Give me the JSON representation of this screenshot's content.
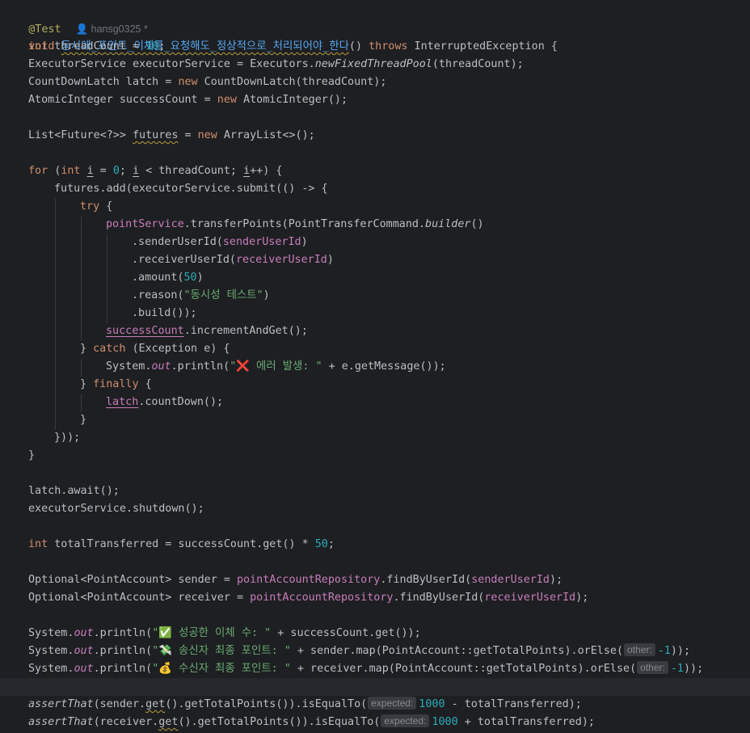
{
  "header": {
    "annotation": "@Test",
    "author": "hansg0325 *",
    "void_kw": "void",
    "method_name": "동시에_포인트_이체를_요청해도_정상적으로_처리되어야_한다",
    "method_params": "() ",
    "throws_kw": "throws",
    "method_tail": " InterruptedException {"
  },
  "icons": {
    "author": "person-icon",
    "error": "cross-mark-icon",
    "success": "check-mark-icon",
    "sender": "money-wings-icon",
    "receiver": "money-bag-icon"
  },
  "colors": {
    "background": "#1e1f22",
    "keyword": "#cf8e6d",
    "string": "#6aab73",
    "number": "#2aacb8",
    "field": "#c77dbb"
  },
  "code": {
    "l1_kw": "int",
    "l1_a": " threadCount = ",
    "l1_num": "10",
    "l1_b": ";",
    "l2_a": "ExecutorService executorService = Executors.",
    "l2_m": "newFixedThreadPool",
    "l2_b": "(threadCount);",
    "l3_a": "CountDownLatch latch = ",
    "l3_kw": "new",
    "l3_b": " CountDownLatch(threadCount);",
    "l4_a": "AtomicInteger successCount = ",
    "l4_kw": "new",
    "l4_b": " AtomicInteger();",
    "l5_a": "List<Future<?>> ",
    "l5_v": "futures",
    "l5_b": " = ",
    "l5_kw": "new",
    "l5_c": " ArrayList<>();",
    "l6_kw1": "for",
    "l6_a": " (",
    "l6_kw2": "int",
    "l6_b": " ",
    "l6_i1": "i",
    "l6_c": " = ",
    "l6_num": "0",
    "l6_d": "; ",
    "l6_i2": "i",
    "l6_e": " < threadCount; ",
    "l6_i3": "i",
    "l6_f": "++) {",
    "l7": "futures.add(executorService.submit(() -> {",
    "l8_kw": "try",
    "l8_b": " {",
    "l9_f": "pointService",
    "l9_a": ".transferPoints(PointTransferCommand.",
    "l9_m": "builder",
    "l9_b": "()",
    "l10_a": ".senderUserId(",
    "l10_f": "senderUserId",
    "l10_b": ")",
    "l11_a": ".receiverUserId(",
    "l11_f": "receiverUserId",
    "l11_b": ")",
    "l12_a": ".amount(",
    "l12_num": "50",
    "l12_b": ")",
    "l13_a": ".reason(",
    "l13_str": "\"동시성 테스트\"",
    "l13_b": ")",
    "l14": ".build());",
    "l15_f": "successCount",
    "l15_a": ".incrementAndGet();",
    "l16_a": "} ",
    "l16_kw": "catch",
    "l16_b": " (Exception e) {",
    "l17_a": "System.",
    "l17_out": "out",
    "l17_b": ".println(",
    "l17_q": "\"",
    "l17_icon": "❌",
    "l17_str": " 에러 발생: \"",
    "l17_c": " + e.getMessage());",
    "l18_a": "} ",
    "l18_kw": "finally",
    "l18_b": " {",
    "l19_f": "latch",
    "l19_a": ".countDown();",
    "l20": "}",
    "l21": "}));",
    "l22": "}",
    "l23": "latch.await();",
    "l24": "executorService.shutdown();",
    "l25_kw": "int",
    "l25_a": " totalTransferred = successCount.get() * ",
    "l25_num": "50",
    "l25_b": ";",
    "l26_a": "Optional<PointAccount> sender = ",
    "l26_f": "pointAccountRepository",
    "l26_b": ".findByUserId(",
    "l26_f2": "senderUserId",
    "l26_c": ");",
    "l27_a": "Optional<PointAccount> receiver = ",
    "l27_f": "pointAccountRepository",
    "l27_b": ".findByUserId(",
    "l27_f2": "receiverUserId",
    "l27_c": ");",
    "l28_a": "System.",
    "l28_out": "out",
    "l28_b": ".println(",
    "l28_q": "\"",
    "l28_icon": "✅",
    "l28_str": " 성공한 이체 수: \"",
    "l28_c": " + successCount.get());",
    "l29_a": "System.",
    "l29_out": "out",
    "l29_b": ".println(",
    "l29_q": "\"",
    "l29_icon": "💸",
    "l29_str": " 송신자 최종 포인트: \"",
    "l29_c": " + sender.map(PointAccount::getTotalPoints).orElse(",
    "l29_hint": "other:",
    "l29_num": "-1",
    "l29_d": "));",
    "l30_a": "System.",
    "l30_out": "out",
    "l30_b": ".println(",
    "l30_q": "\"",
    "l30_icon": "💰",
    "l30_str": " 수신자 최종 포인트: \"",
    "l30_c": " + receiver.map(PointAccount::getTotalPoints).orElse(",
    "l30_hint": "other:",
    "l30_num": "-1",
    "l30_d": "));",
    "l31_m": "assertThat",
    "l31_a": "(sender.",
    "l31_g": "get",
    "l31_b": "().getTotalPoints()).isEqualTo(",
    "l31_hint": "expected:",
    "l31_num": "1000",
    "l31_c": " - totalTransferred);",
    "l32_m": "assertThat",
    "l32_a": "(receiver.",
    "l32_g": "get",
    "l32_b": "().getTotalPoints()).isEqualTo(",
    "l32_hint": "expected:",
    "l32_num": "1000",
    "l32_c": " + totalTransferred);"
  }
}
